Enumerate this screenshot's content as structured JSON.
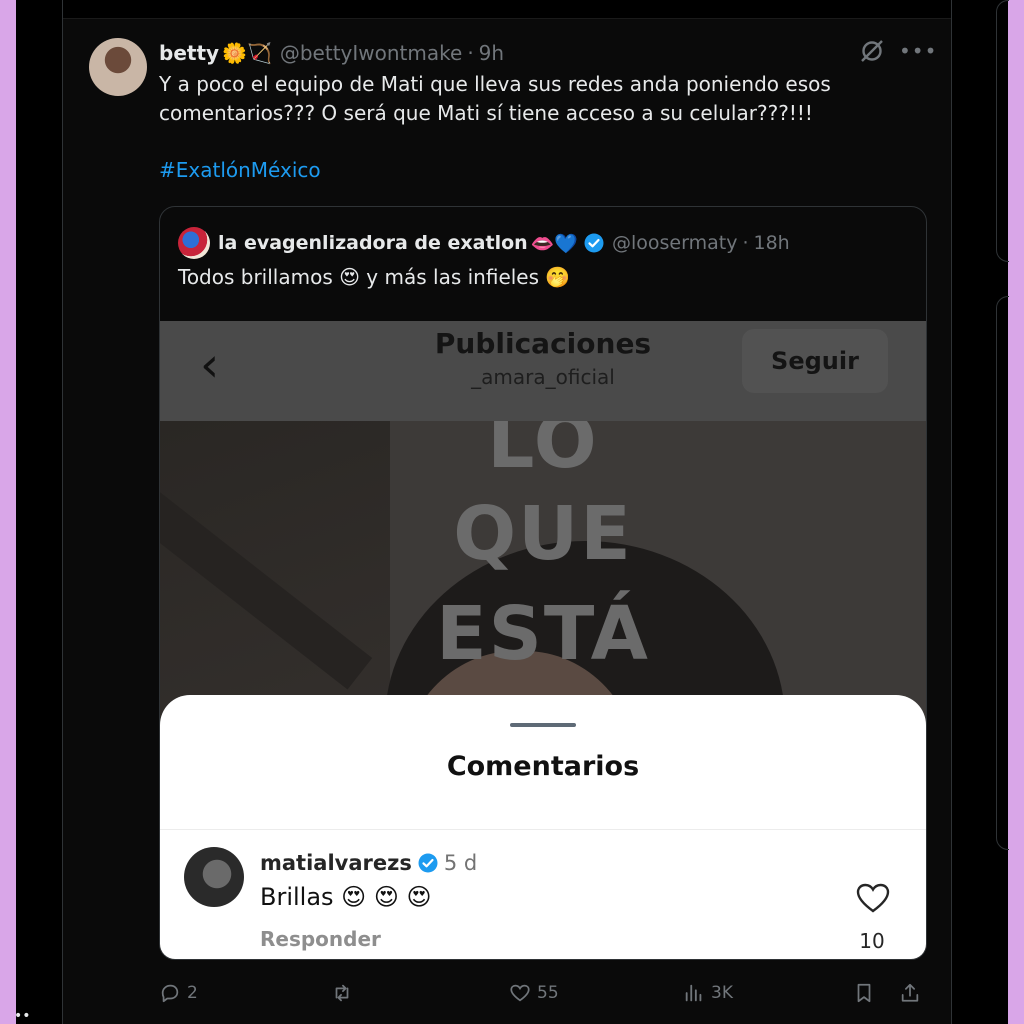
{
  "tweet": {
    "display_name": "betty",
    "name_emojis": "🌼🏹",
    "handle": "@bettyIwontmake",
    "time": "9h",
    "text": "Y a poco el equipo de Mati que lleva sus redes anda poniendo esos comentarios??? O será que Mati sí tiene acceso a su celular???!!!",
    "hashtag": "#ExatlónMéxico"
  },
  "quote": {
    "display_name": "la evagenlizadora de exatlon",
    "name_emojis": "👄💙",
    "handle": "@loosermaty",
    "time": "18h",
    "text": "Todos brillamos 😍 y más las infieles 🤭"
  },
  "screenshot": {
    "title": "Publicaciones",
    "subtitle": "_amara_oficial",
    "follow_label": "Seguir",
    "overlay_words": [
      "LO",
      "QUE",
      "ESTÁ"
    ],
    "comments_title": "Comentarios",
    "comment": {
      "username": "matialvarezs",
      "time": "5 d",
      "text": "Brillas 😍 😍 😍",
      "reply_label": "Responder",
      "likes": "10"
    }
  },
  "actions": {
    "replies": "2",
    "reposts": "",
    "likes": "55",
    "views": "3K"
  },
  "colors": {
    "accent": "#1d9bf0",
    "muted": "#71767b",
    "frame": "#d9a6e8",
    "background": "#000000"
  },
  "icons": [
    "grok-icon",
    "more-icon",
    "verified-badge-icon",
    "back-chevron-icon",
    "heart-icon",
    "reply-icon",
    "repost-icon",
    "like-icon",
    "views-icon",
    "bookmark-icon",
    "share-icon"
  ],
  "footer": {
    "dots": "••"
  }
}
